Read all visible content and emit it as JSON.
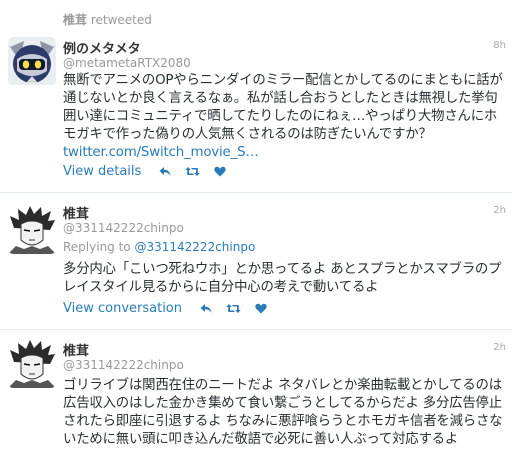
{
  "tweet1": {
    "retweet_by": "椎茸",
    "retweet_label": "retweeted",
    "name": "例のメタメタ",
    "handle": "@metametaRTX2080",
    "time": "8h",
    "text": "無断でアニメのOPやらニンダイのミラー配信とかしてるのにまともに話が通じないとか良く言えるなぁ。私が話し合おうとしたときは無視した挙句囲い達にコミュニティで晒してたりしたのにねぇ…やっぱり大物さんにホモガキで作った偽りの人気無くされるのは防ぎたいんですか？",
    "link": "twitter.com/Switch_movie_S…",
    "action_label": "View details"
  },
  "tweet2": {
    "name": "椎茸",
    "handle": "@331142222chinpo",
    "time": "2h",
    "reply_prefix": "Replying to",
    "reply_handle": "@331142222chinpo",
    "text": "多分内心「こいつ死ねウホ」とか思ってるよ あとスプラとかスマブラのプレイスタイル見るからに自分中心の考えで動いてるよ",
    "action_label": "View conversation"
  },
  "tweet3": {
    "name": "椎茸",
    "handle": "@331142222chinpo",
    "time": "2h",
    "text": "ゴリライブは関西在住のニートだよ ネタバレとか楽曲転載とかしてるのは広告収入のはした金かき集めて食い繋ごうとしてるからだよ 多分広告停止されたら即座に引退するよ ちなみに悪評喰らうとホモガキ信者を減らさないために無い頭に叩き込んだ敬語で必死に善い人ぶって対応するよ"
  },
  "icons": [
    "retweet-context-icon",
    "reply-icon",
    "retweet-icon",
    "like-icon"
  ],
  "colors": {
    "link": "#2b7bb9",
    "muted": "#999999",
    "text": "#292f33",
    "divider": "#e1e8ed"
  }
}
